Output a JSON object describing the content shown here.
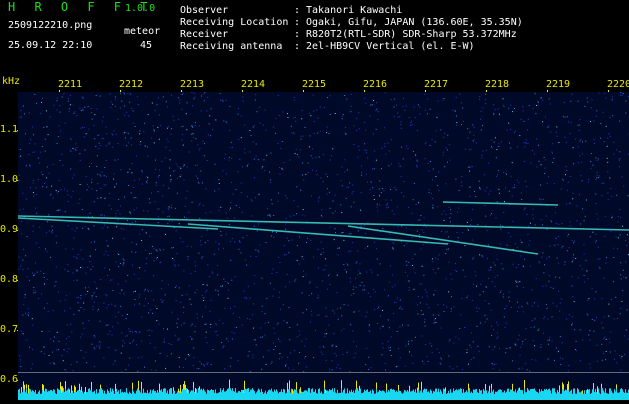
{
  "header": {
    "app_name": "H R O F F T",
    "version": "1.0.0",
    "filename": "2509122210.png",
    "datetime": "25.09.12 22:10",
    "meteor_label": "meteor",
    "meteor_count": "45",
    "info": [
      {
        "label": "Observer",
        "value": "Takanori Kawachi"
      },
      {
        "label": "Receiving Location",
        "value": "Ogaki, Gifu, JAPAN (136.60E, 35.35N)"
      },
      {
        "label": "Receiver",
        "value": "R820T2(RTL-SDR) SDR-Sharp 53.372MHz"
      },
      {
        "label": "Receiving antenna",
        "value": "2el-HB9CV Vertical (el. E-W)"
      }
    ],
    "colon": ":"
  },
  "axis": {
    "unit": "kHz",
    "time_ticks": [
      "2211",
      "2212",
      "2213",
      "2214",
      "2215",
      "2216",
      "2217",
      "2218",
      "2219",
      "2220"
    ],
    "freq_ticks": [
      "1.1",
      "1.0",
      "0.9",
      "0.8",
      "0.7",
      "0.6"
    ]
  },
  "colors": {
    "title_green": "#19e019",
    "axis_yellow": "#e8e800",
    "background": "#000a28",
    "trace": "#3fd8c8"
  }
}
